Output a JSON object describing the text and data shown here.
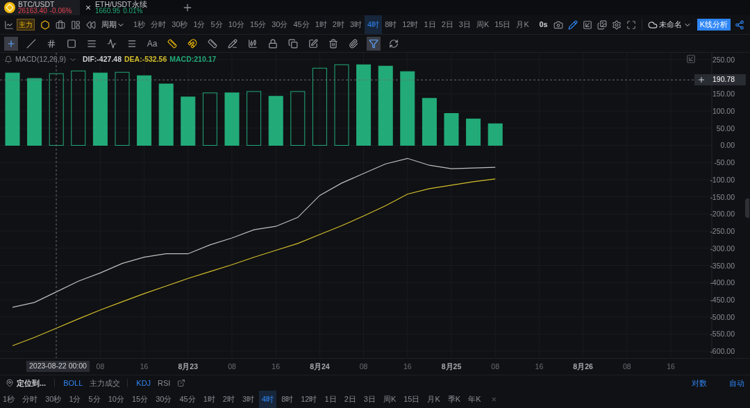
{
  "tickers": [
    {
      "symbol": "BTC/USDT",
      "price": "26163.40",
      "change": "-0.06%",
      "color": "#e0424f",
      "selected": true
    },
    {
      "symbol": "ETH/USDT永续",
      "price": "1660.95",
      "change": "0.01%",
      "color": "#22ab79",
      "selected": false
    }
  ],
  "toolbar": {
    "main_badge": "主力",
    "period_menu": "周期",
    "periods": [
      {
        "label": "1秒",
        "selected": false
      },
      {
        "label": "分时",
        "selected": false
      },
      {
        "label": "30秒",
        "selected": false
      },
      {
        "label": "1分",
        "selected": false
      },
      {
        "label": "5分",
        "selected": false
      },
      {
        "label": "10分",
        "selected": false
      },
      {
        "label": "15分",
        "selected": false
      },
      {
        "label": "30分",
        "selected": false
      },
      {
        "label": "45分",
        "selected": false
      },
      {
        "label": "1时",
        "selected": false
      },
      {
        "label": "2时",
        "selected": false
      },
      {
        "label": "3时",
        "selected": false
      },
      {
        "label": "4时",
        "selected": true
      },
      {
        "label": "8时",
        "selected": false
      },
      {
        "label": "12时",
        "selected": false
      },
      {
        "label": "1日",
        "selected": false
      },
      {
        "label": "2日",
        "selected": false
      },
      {
        "label": "3日",
        "selected": false
      },
      {
        "label": "周K",
        "selected": false
      },
      {
        "label": "15日",
        "selected": false
      },
      {
        "label": "月K",
        "selected": false
      }
    ],
    "countdown": "0s",
    "layout_name": "未命名",
    "analysis_button": "K线分析"
  },
  "drawing_tools": [
    {
      "selected": true,
      "on": false
    },
    {
      "selected": false,
      "on": false
    },
    {
      "selected": false,
      "on": false
    },
    {
      "selected": false,
      "on": false
    },
    {
      "selected": false,
      "on": false
    },
    {
      "selected": false,
      "on": false
    },
    {
      "selected": false,
      "on": false
    },
    {
      "label": "Aa",
      "selected": false,
      "on": false
    },
    {
      "selected": false,
      "on": true
    },
    {
      "selected": false,
      "on": true
    },
    {
      "selected": false,
      "on": false
    },
    {
      "selected": false,
      "on": false
    },
    {
      "selected": false,
      "on": false
    },
    {
      "selected": false,
      "on": false
    },
    {
      "selected": false,
      "on": false
    },
    {
      "selected": false,
      "on": false
    },
    {
      "selected": false,
      "on": false
    },
    {
      "selected": false,
      "on": false
    },
    {
      "selected": true,
      "on": false
    },
    {
      "selected": false,
      "on": false
    }
  ],
  "indicator_legend": {
    "name": "MACD(12,26,9)",
    "dif": "DIF:-427.48",
    "dea": "DEA:-532.56",
    "macd": "MACD:210.17"
  },
  "crosshair": {
    "price": "190.78",
    "time": "2023-08-22 00:00"
  },
  "macd_chart": {
    "chart_data": {
      "type": "bar",
      "grid": true,
      "ylim": [
        -620,
        270
      ],
      "categories": [
        null,
        null,
        null,
        null,
        "08",
        null,
        "16",
        null,
        "8月23",
        null,
        "08",
        null,
        "16",
        null,
        "8月24",
        null,
        "08",
        null,
        "16",
        null,
        "8月25",
        null,
        "08",
        null,
        "16",
        null,
        "8月26",
        null,
        "08",
        null,
        "16",
        null
      ],
      "yticks": [
        {
          "value": 250,
          "label": "250.00"
        },
        {
          "value": 150,
          "label": "150.00"
        },
        {
          "value": 100,
          "label": "100.00"
        },
        {
          "value": 50,
          "label": "50.00"
        },
        {
          "value": 0,
          "label": "0.00"
        },
        {
          "value": -50,
          "label": "-50.00"
        },
        {
          "value": -100,
          "label": "-100.00"
        },
        {
          "value": -150,
          "label": "-150.00"
        },
        {
          "value": -200,
          "label": "-200.00"
        },
        {
          "value": -250,
          "label": "-250.00"
        },
        {
          "value": -300,
          "label": "-300.00"
        },
        {
          "value": -350,
          "label": "-350.00"
        },
        {
          "value": -400,
          "label": "-400.00"
        },
        {
          "value": -450,
          "label": "-450.00"
        },
        {
          "value": -500,
          "label": "-500.00"
        },
        {
          "value": -550,
          "label": "-550.00"
        },
        {
          "value": -600,
          "label": "-600.00"
        }
      ],
      "series": [
        {
          "color": "#22ab79",
          "values": [
            212,
            196,
            210,
            218,
            212,
            214,
            204,
            180,
            142,
            154,
            154,
            158,
            144,
            158,
            226,
            236,
            236,
            232,
            216,
            138,
            94,
            78,
            64,
            null,
            null,
            null,
            null,
            null,
            null,
            null,
            null,
            null
          ]
        },
        {
          "type": "line",
          "color": "#bfbfbf",
          "values": [
            -472,
            -458,
            -427,
            -396,
            -372,
            -344,
            -326,
            -316,
            -316,
            -290,
            -270,
            -246,
            -236,
            -210,
            -146,
            -110,
            -82,
            -54,
            -38,
            -58,
            -68,
            -66,
            -64,
            null,
            null,
            null,
            null,
            null,
            null,
            null,
            null,
            null
          ]
        },
        {
          "type": "line",
          "color": "#d4bf2b",
          "values": [
            -584,
            -560,
            -533,
            -506,
            -480,
            -456,
            -432,
            -410,
            -388,
            -368,
            -348,
            -326,
            -306,
            -286,
            -260,
            -234,
            -206,
            -176,
            -142,
            -126,
            -116,
            -106,
            -98,
            null,
            null,
            null,
            null,
            null,
            null,
            null,
            null,
            null
          ]
        }
      ]
    }
  },
  "bottom_bar": {
    "locate": "定位到...",
    "main_indicators": [
      {
        "label": "BOLL",
        "selected": true
      },
      {
        "label": "主力成交",
        "selected": false
      }
    ],
    "sub_indicators": [
      {
        "label": "KDJ",
        "selected": true
      },
      {
        "label": "RSI",
        "selected": false
      }
    ],
    "scale_options": [
      {
        "label": "对数",
        "selected": true
      },
      {
        "label": "自动",
        "selected": true
      }
    ],
    "periods": [
      {
        "label": "1秒",
        "selected": false
      },
      {
        "label": "分时",
        "selected": false
      },
      {
        "label": "30秒",
        "selected": false
      },
      {
        "label": "1分",
        "selected": false
      },
      {
        "label": "5分",
        "selected": false
      },
      {
        "label": "10分",
        "selected": false
      },
      {
        "label": "15分",
        "selected": false
      },
      {
        "label": "30分",
        "selected": false
      },
      {
        "label": "45分",
        "selected": false
      },
      {
        "label": "1时",
        "selected": false
      },
      {
        "label": "2时",
        "selected": false
      },
      {
        "label": "3时",
        "selected": false
      },
      {
        "label": "4时",
        "selected": true
      },
      {
        "label": "8时",
        "selected": false
      },
      {
        "label": "12时",
        "selected": false
      },
      {
        "label": "1日",
        "selected": false
      },
      {
        "label": "2日",
        "selected": false
      },
      {
        "label": "3日",
        "selected": false
      },
      {
        "label": "周K",
        "selected": false
      },
      {
        "label": "15日",
        "selected": false
      },
      {
        "label": "月K",
        "selected": false
      },
      {
        "label": "季K",
        "selected": false
      },
      {
        "label": "年K",
        "selected": false
      }
    ],
    "close": "×"
  }
}
